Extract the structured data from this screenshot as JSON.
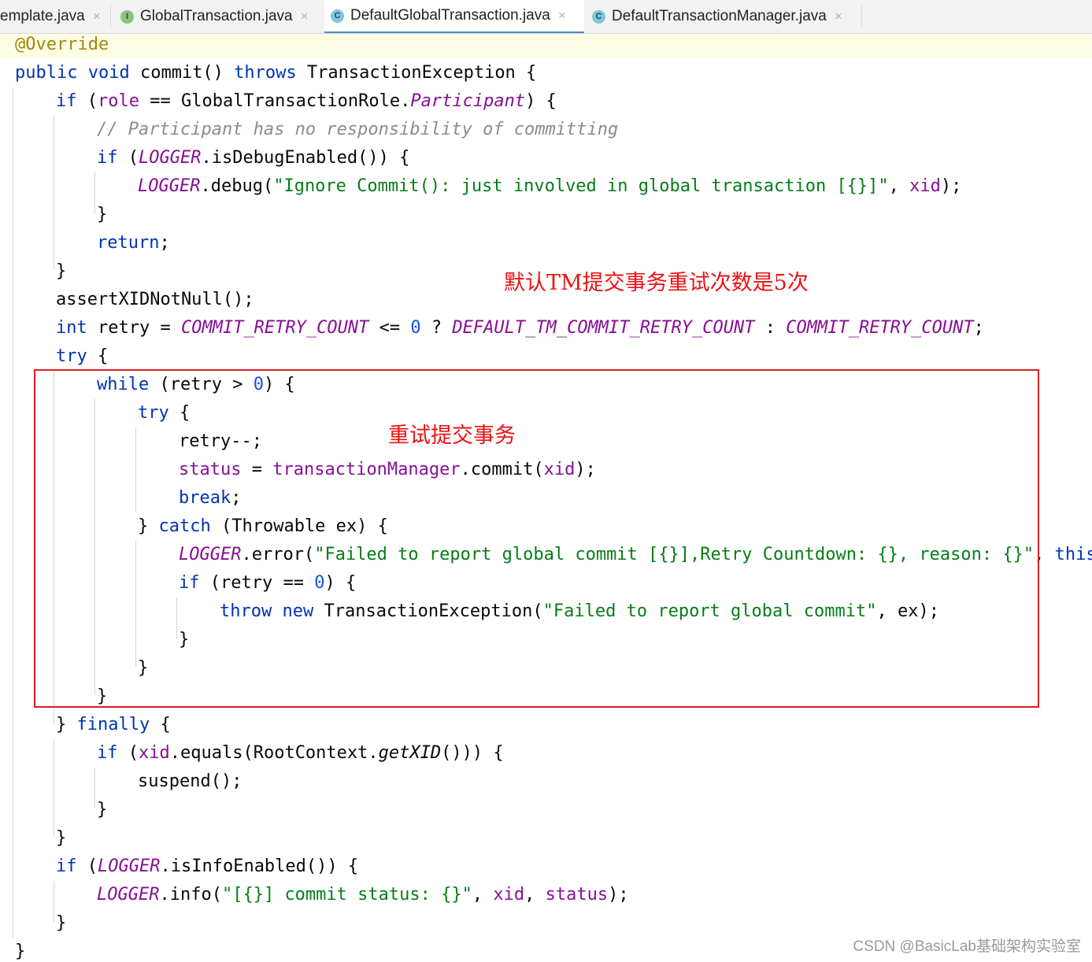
{
  "tabs": [
    {
      "label": "emplate.java",
      "icon": "none",
      "active": false
    },
    {
      "label": "GlobalTransaction.java",
      "icon": "interface-file-icon",
      "icon_letter": "I",
      "active": false
    },
    {
      "label": "DefaultGlobalTransaction.java",
      "icon": "class-file-icon",
      "icon_letter": "C",
      "active": true
    },
    {
      "label": "DefaultTransactionManager.java",
      "icon": "class-file-icon",
      "icon_letter": "C",
      "active": false
    }
  ],
  "close_glyph": "×",
  "code": {
    "l1": [
      "@Override"
    ],
    "l2": [
      "public",
      " ",
      "void",
      " commit() ",
      "throws",
      " TransactionException {"
    ],
    "l3": [
      "if",
      " (",
      "role",
      " == GlobalTransactionRole.",
      "Participant",
      ") {"
    ],
    "l4": [
      "// Participant has no responsibility of committing"
    ],
    "l5": [
      "if",
      " (",
      "LOGGER",
      ".isDebugEnabled()) {"
    ],
    "l6": [
      "LOGGER",
      ".debug(",
      "\"Ignore Commit(): just involved in global transaction [{}]\"",
      ", ",
      "xid",
      ");"
    ],
    "l7": [
      "}"
    ],
    "l8": [
      "return",
      ";"
    ],
    "l9": [
      "}"
    ],
    "l10": [
      "assertXIDNotNull();"
    ],
    "l11": [
      "int",
      " retry = ",
      "COMMIT_RETRY_COUNT",
      " <= ",
      "0",
      " ? ",
      "DEFAULT_TM_COMMIT_RETRY_COUNT",
      " : ",
      "COMMIT_RETRY_COUNT",
      ";"
    ],
    "l12": [
      "try",
      " {"
    ],
    "l13": [
      "while",
      " (retry > ",
      "0",
      ") {"
    ],
    "l14": [
      "try",
      " {"
    ],
    "l15": [
      "retry--;"
    ],
    "l16": [
      "status",
      " = ",
      "transactionManager",
      ".commit(",
      "xid",
      ");"
    ],
    "l17": [
      "break",
      ";"
    ],
    "l18": [
      "} ",
      "catch",
      " (Throwable ex) {"
    ],
    "l19": [
      "LOGGER",
      ".error(",
      "\"Failed to report global commit [{}],Retry Countdown: {}, reason: {}\"",
      ", ",
      "this",
      "."
    ],
    "l20": [
      "if",
      " (retry == ",
      "0",
      ") {"
    ],
    "l21": [
      "throw",
      " ",
      "new",
      " TransactionException(",
      "\"Failed to report global commit\"",
      ", ex);"
    ],
    "l22": [
      "}"
    ],
    "l23": [
      "}"
    ],
    "l24": [
      "}"
    ],
    "l25": [
      "} ",
      "finally",
      " {"
    ],
    "l26": [
      "if",
      " (",
      "xid",
      ".equals(RootContext.",
      "getXID",
      "())) {"
    ],
    "l27": [
      "suspend();"
    ],
    "l28": [
      "}"
    ],
    "l29": [
      "}"
    ],
    "l30": [
      "if",
      " (",
      "LOGGER",
      ".isInfoEnabled()) {"
    ],
    "l31": [
      "LOGGER",
      ".info(",
      "\"[{}] commit status: {}\"",
      ", ",
      "xid",
      ", ",
      "status",
      ");"
    ],
    "l32": [
      "}"
    ],
    "l33": [
      "}"
    ]
  },
  "annotations": {
    "retry_default": "默认TM提交事务重试次数是5次",
    "retry_commit": "重试提交事务",
    "box_color": "#e01b24"
  },
  "watermark": "CSDN @BasicLab基础架构实验室"
}
